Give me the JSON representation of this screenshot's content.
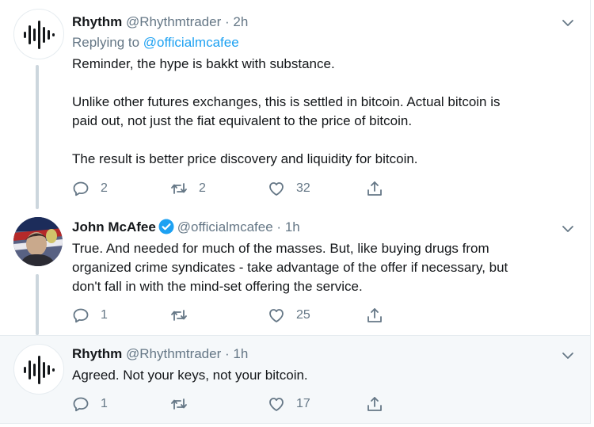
{
  "tweets": [
    {
      "name": "Rhythm",
      "handle": "@Rhythmtrader",
      "time": "2h",
      "replying_prefix": "Replying to",
      "replying_handle": "@officialmcafee",
      "body": [
        "Reminder, the hype is bakkt with substance.",
        "Unlike other futures exchanges, this is settled in bitcoin. Actual bitcoin is",
        "paid out, not just the fiat equivalent to the price of bitcoin.",
        "The result is better price discovery and liquidity for bitcoin."
      ],
      "replies": "2",
      "retweets": "2",
      "likes": "32"
    },
    {
      "name": "John McAfee",
      "handle": "@officialmcafee",
      "time": "1h",
      "verified": true,
      "body": [
        "True. And needed for much of the masses. But, like buying drugs from",
        "organized crime syndicates - take advantage of the offer if necessary, but",
        "don't fall in with the mind-set offering the service."
      ],
      "replies": "1",
      "retweets": "",
      "likes": "25"
    },
    {
      "name": "Rhythm",
      "handle": "@Rhythmtrader",
      "time": "1h",
      "body": [
        "Agreed. Not your keys, not your bitcoin."
      ],
      "replies": "1",
      "retweets": "",
      "likes": "17"
    }
  ],
  "separator": "·",
  "colors": {
    "accent": "#1da1f2",
    "secondary_text": "#657786",
    "highlight_bg": "#f5f8fa",
    "thread_line": "#ccd6dd"
  },
  "icons": [
    "rhythm-logo-icon",
    "chevron-down-icon",
    "reply-icon",
    "retweet-icon",
    "like-icon",
    "share-icon",
    "verified-badge-icon"
  ]
}
